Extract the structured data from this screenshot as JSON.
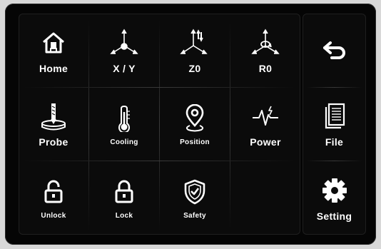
{
  "main_grid": {
    "row1": [
      {
        "label": "Home",
        "icon": "home-icon"
      },
      {
        "label": "X / Y",
        "icon": "xy-axes-icon"
      },
      {
        "label": "Z0",
        "icon": "z-axis-icon"
      },
      {
        "label": "R0",
        "icon": "rotation-axis-icon"
      }
    ],
    "row2": [
      {
        "label": "Probe",
        "icon": "probe-icon"
      },
      {
        "label": "Cooling",
        "icon": "thermometer-icon"
      },
      {
        "label": "Position",
        "icon": "location-pin-icon"
      },
      {
        "label": "Power",
        "icon": "power-pulse-icon"
      }
    ],
    "row3": [
      {
        "label": "Unlock",
        "icon": "unlocked-padlock-icon"
      },
      {
        "label": "Lock",
        "icon": "locked-padlock-icon"
      },
      {
        "label": "Safety",
        "icon": "shield-check-icon"
      }
    ]
  },
  "side_menu": {
    "back": {
      "icon": "back-arrow-icon"
    },
    "file": {
      "label": "File",
      "icon": "file-document-icon"
    },
    "setting": {
      "label": "Setting",
      "icon": "gear-icon"
    }
  },
  "colors": {
    "background": "#050505",
    "foreground": "#ffffff",
    "divider": "#3a3a3a"
  }
}
